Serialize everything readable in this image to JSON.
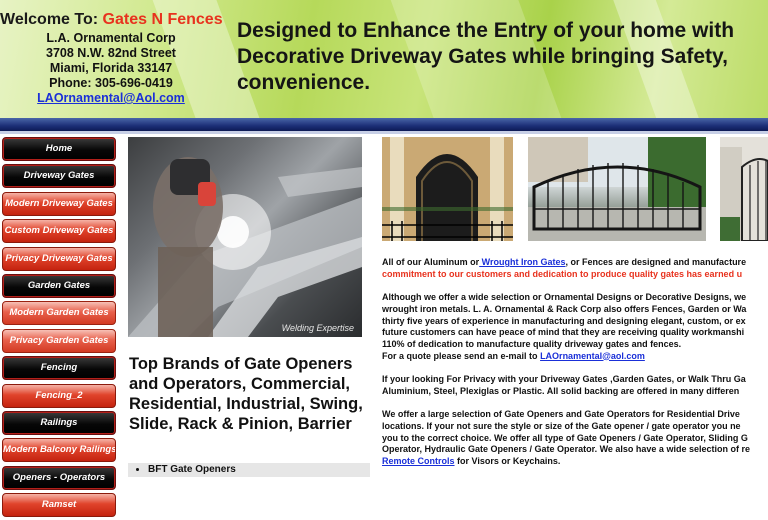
{
  "header": {
    "welcome_prefix": "Welcome To:",
    "brand": "Gates N Fences",
    "company": "L.A. Ornamental Corp",
    "street": "3708 N.W. 82nd Street",
    "city": "Miami, Florida 33147",
    "phone": "Phone: 305-696-0419",
    "email": "LAOrnamental@Aol.com",
    "headline": "Designed to Enhance the Entry of your home with Decorative Driveway Gates while bringing Safety, convenience."
  },
  "nav": {
    "items": [
      {
        "label": "Home",
        "style": "black"
      },
      {
        "label": "Driveway Gates",
        "style": "black"
      },
      {
        "label": "Modern Driveway Gates",
        "style": "red"
      },
      {
        "label": "Custom Driveway Gates",
        "style": "red"
      },
      {
        "label": "Privacy Driveway Gates",
        "style": "red"
      },
      {
        "label": "Garden Gates",
        "style": "black"
      },
      {
        "label": "Modern Garden Gates",
        "style": "pink"
      },
      {
        "label": "Privacy Garden Gates",
        "style": "pink"
      },
      {
        "label": "Fencing",
        "style": "black"
      },
      {
        "label": "Fencing_2",
        "style": "red"
      },
      {
        "label": "Railings",
        "style": "black"
      },
      {
        "label": "Modern Balcony Railings",
        "style": "red"
      },
      {
        "label": "Openers - Operators",
        "style": "black"
      },
      {
        "label": "Ramset",
        "style": "red"
      }
    ]
  },
  "main": {
    "welding_caption": "Welding Expertise",
    "brands_heading": "Top Brands of Gate Openers and Operators, Commercial, Residential, Industrial, Swing, Slide, Rack & Pinion, Barrier",
    "brand_items": [
      "BFT Gate Openers"
    ]
  },
  "right": {
    "p1_start": "All of our Aluminum or",
    "p1_link": " Wrought Iron Gates",
    "p1_end": ", or Fences are designed and manufacture",
    "p1_red": "commitment to our customers and dedication to produce quality gates has earned u",
    "p2_lines": [
      "Although we offer a wide selection or Ornamental Designs or Decorative Designs, we",
      "wrought iron metals. L. A. Ornamental & Rack Corp also offers Fences, Garden or Wa",
      "thirty five years of experience in manufacturing and designing elegant, custom, or ex",
      "future customers can have peace of mind that they are receiving quality workmanshi",
      "110% of dedication to manufacture quality driveway gates and fences."
    ],
    "p2_quote": "For a quote please send an e-mail to",
    "p2_email": "LAOrnamental@aol.com",
    "p3_lines": [
      "If your looking For Privacy with your Driveway Gates ,Garden Gates, or Walk Thru Ga",
      "Aluminium, Steel, Plexiglas or Plastic.  All solid backing are offered in many differen"
    ],
    "p4_lines": [
      "We offer a large selection of  Gate Openers and Gate Operators for Residential Drive",
      "locations. If your not sure the style or size of the Gate opener / gate operator  you ne",
      "you to the correct choice. We offer all type of Gate Openers / Gate Operator, Sliding G",
      "Operator, Hydraulic Gate Openers / Gate Operator. We also have a wide selection of re"
    ],
    "p4_link": "Remote Controls",
    "p4_end": "  for Visors or Keychains."
  }
}
